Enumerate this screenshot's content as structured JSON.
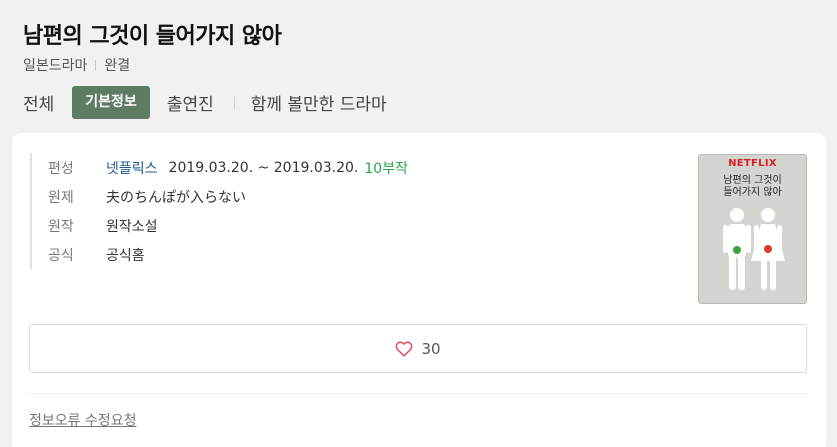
{
  "title": "남편의 그것이 들어가지 않아",
  "meta": {
    "category": "일본드라마",
    "status": "완결"
  },
  "tabs": {
    "all": "전체",
    "info": "기본정보",
    "cast": "출연진",
    "similar": "함께 볼만한 드라마"
  },
  "info": {
    "broadcast_label": "편성",
    "network": "넷플릭스",
    "dates": "2019.03.20. ~ 2019.03.20.",
    "episodes": "10부작",
    "original_title_label": "원제",
    "original_title": "夫のちんぽが入らない",
    "source_label": "원작",
    "source": "원작소설",
    "official_label": "공식",
    "official": "공식홈"
  },
  "poster": {
    "brand": "NETFLIX",
    "title_line1": "남편의 그것이",
    "title_line2": "들어가지 않아"
  },
  "likes": {
    "count": "30",
    "icon": "heart-icon"
  },
  "report": "정보오류 수정요청",
  "colors": {
    "active_tab": "#5e7b63",
    "link": "#1b5c90",
    "episodes": "#2ea44f",
    "heart": "#e0445a"
  }
}
